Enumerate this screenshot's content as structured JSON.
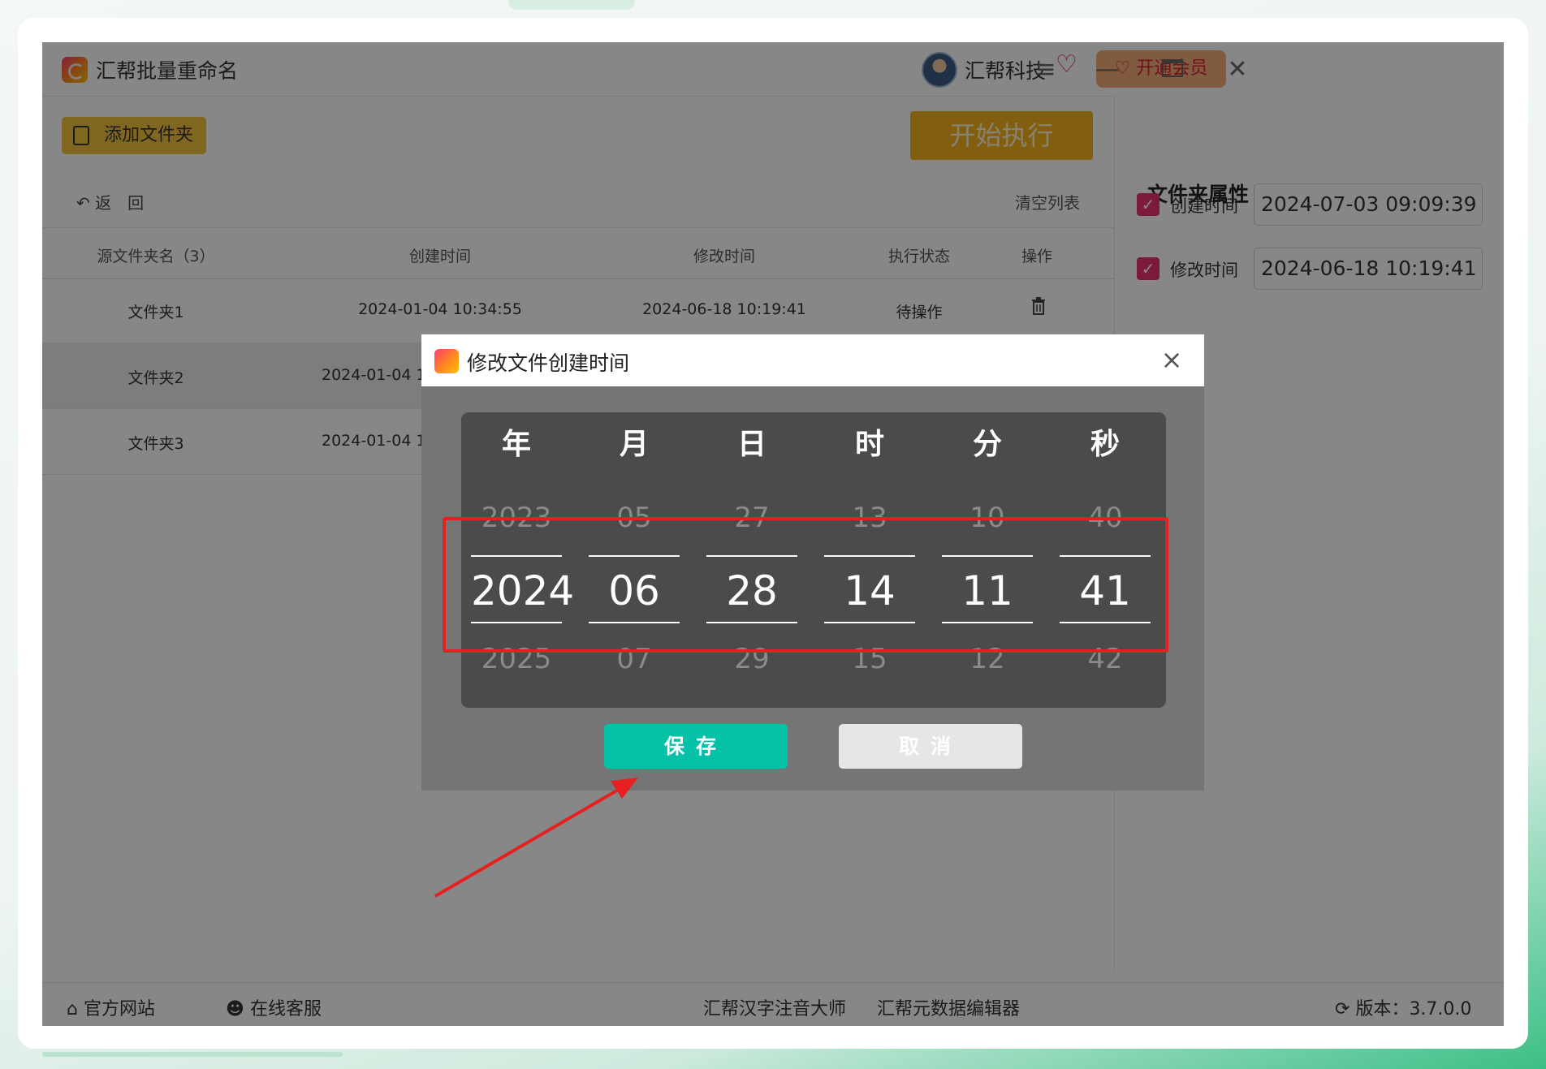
{
  "titlebar": {
    "app_title": "汇帮批量重命名",
    "user_name": "汇帮科技",
    "vip_label": "开通会员"
  },
  "toolbar": {
    "add_folder_label": "添加文件夹",
    "start_label": "开始执行",
    "back_label": "返　回",
    "clear_label": "清空列表"
  },
  "table": {
    "headers": [
      "源文件夹名（3）",
      "创建时间",
      "修改时间",
      "执行状态",
      "操作"
    ],
    "rows": [
      {
        "name": "文件夹1",
        "created": "2024-01-04 10:34:55",
        "modified": "2024-06-18 10:19:41",
        "status": "待操作"
      },
      {
        "name": "文件夹2",
        "created": "2024-01-04 1"
      },
      {
        "name": "文件夹3",
        "created": "2024-01-04 1"
      }
    ]
  },
  "props": {
    "title": "文件夹属性",
    "created_label": "创建时间",
    "created_value": "2024-07-03 09:09:39",
    "modified_label": "修改时间",
    "modified_value": "2024-06-18 10:19:41"
  },
  "footer": {
    "website": "官方网站",
    "support": "在线客服",
    "link1": "汇帮汉字注音大师",
    "link2": "汇帮元数据编辑器",
    "version": "版本：3.7.0.0"
  },
  "modal": {
    "title": "修改文件创建时间",
    "save_label": "保存",
    "cancel_label": "取消",
    "columns": [
      {
        "header": "年",
        "prev": "2023",
        "current": "2024",
        "next": "2025"
      },
      {
        "header": "月",
        "prev": "05",
        "current": "06",
        "next": "07"
      },
      {
        "header": "日",
        "prev": "27",
        "current": "28",
        "next": "29"
      },
      {
        "header": "时",
        "prev": "13",
        "current": "14",
        "next": "15"
      },
      {
        "header": "分",
        "prev": "10",
        "current": "11",
        "next": "12"
      },
      {
        "header": "秒",
        "prev": "40",
        "current": "41",
        "next": "42"
      }
    ]
  },
  "colors": {
    "accent_red": "#e62020",
    "save_teal": "#04c1a8",
    "start_orange": "#f5b31d",
    "checkbox_pink": "#e8336d"
  }
}
